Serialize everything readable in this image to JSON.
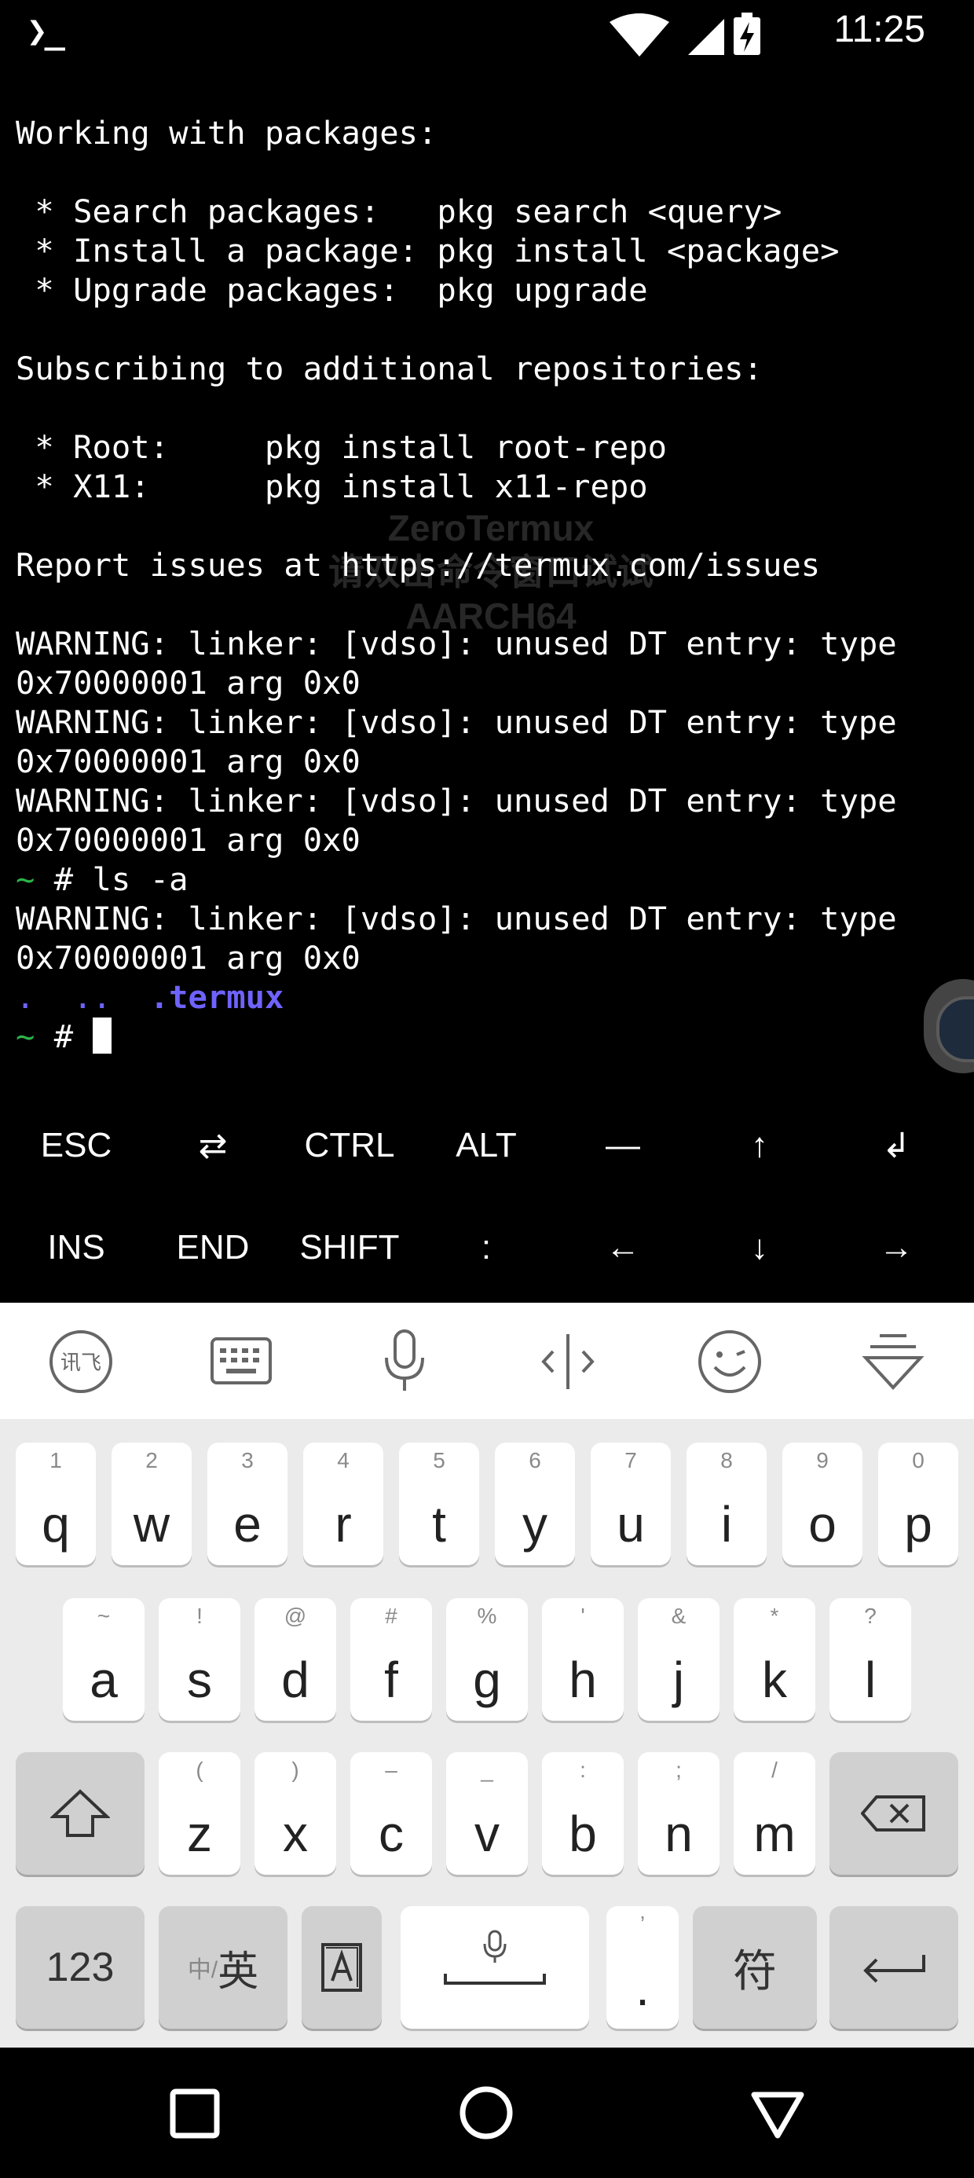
{
  "status_bar": {
    "app_glyph": "❯_",
    "time": "11:25",
    "icons": [
      "wifi-icon",
      "signal-icon",
      "battery-charging-icon"
    ]
  },
  "terminal": {
    "lines": [
      {
        "kind": "plain",
        "text": "Working with packages:"
      },
      {
        "kind": "plain",
        "text": ""
      },
      {
        "kind": "plain",
        "text": " * Search packages:   pkg search <query>"
      },
      {
        "kind": "plain",
        "text": " * Install a package: pkg install <package>"
      },
      {
        "kind": "plain",
        "text": " * Upgrade packages:  pkg upgrade"
      },
      {
        "kind": "plain",
        "text": ""
      },
      {
        "kind": "plain",
        "text": "Subscribing to additional repositories:"
      },
      {
        "kind": "plain",
        "text": ""
      },
      {
        "kind": "plain",
        "text": " * Root:     pkg install root-repo"
      },
      {
        "kind": "plain",
        "text": " * X11:      pkg install x11-repo"
      },
      {
        "kind": "plain",
        "text": ""
      },
      {
        "kind": "plain",
        "text": "Report issues at https://termux.com/issues"
      },
      {
        "kind": "plain",
        "text": ""
      },
      {
        "kind": "plain",
        "text": "WARNING: linker: [vdso]: unused DT entry: type"
      },
      {
        "kind": "plain",
        "text": "0x70000001 arg 0x0"
      },
      {
        "kind": "plain",
        "text": "WARNING: linker: [vdso]: unused DT entry: type"
      },
      {
        "kind": "plain",
        "text": "0x70000001 arg 0x0"
      },
      {
        "kind": "plain",
        "text": "WARNING: linker: [vdso]: unused DT entry: type"
      },
      {
        "kind": "plain",
        "text": "0x70000001 arg 0x0"
      },
      {
        "kind": "prompt",
        "prompt": "~",
        "hash": " # ",
        "text": "ls -a"
      },
      {
        "kind": "plain",
        "text": "WARNING: linker: [vdso]: unused DT entry: type"
      },
      {
        "kind": "plain",
        "text": "0x70000001 arg 0x0"
      },
      {
        "kind": "listing",
        "items": [
          ".",
          "..",
          ".termux"
        ]
      },
      {
        "kind": "cursor",
        "prompt": "~",
        "hash": " # "
      }
    ],
    "watermark": [
      "ZeroTermux",
      "请双击命令窗口试试",
      "AARCH64"
    ]
  },
  "extra_keys": {
    "row1": [
      "ESC",
      "⇄",
      "CTRL",
      "ALT",
      "—",
      "↑",
      "↲"
    ],
    "row2": [
      "INS",
      "END",
      "SHIFT",
      ":",
      "←",
      "↓",
      "→"
    ]
  },
  "ime_toolbar": [
    "ime-logo-icon",
    "keyboard-icon",
    "microphone-icon",
    "cursor-move-icon",
    "emoji-icon",
    "collapse-keyboard-icon"
  ],
  "keyboard": {
    "row1": [
      {
        "main": "q",
        "sub": "1"
      },
      {
        "main": "w",
        "sub": "2"
      },
      {
        "main": "e",
        "sub": "3"
      },
      {
        "main": "r",
        "sub": "4"
      },
      {
        "main": "t",
        "sub": "5"
      },
      {
        "main": "y",
        "sub": "6"
      },
      {
        "main": "u",
        "sub": "7"
      },
      {
        "main": "i",
        "sub": "8"
      },
      {
        "main": "o",
        "sub": "9"
      },
      {
        "main": "p",
        "sub": "0"
      }
    ],
    "row2": [
      {
        "main": "a",
        "sub": "~"
      },
      {
        "main": "s",
        "sub": "!"
      },
      {
        "main": "d",
        "sub": "@"
      },
      {
        "main": "f",
        "sub": "#"
      },
      {
        "main": "g",
        "sub": "%"
      },
      {
        "main": "h",
        "sub": "'"
      },
      {
        "main": "j",
        "sub": "&"
      },
      {
        "main": "k",
        "sub": "*"
      },
      {
        "main": "l",
        "sub": "?"
      }
    ],
    "row3": [
      {
        "main": "z",
        "sub": "("
      },
      {
        "main": "x",
        "sub": ")"
      },
      {
        "main": "c",
        "sub": "–"
      },
      {
        "main": "v",
        "sub": "_"
      },
      {
        "main": "b",
        "sub": ":"
      },
      {
        "main": "n",
        "sub": ";"
      },
      {
        "main": "m",
        "sub": "/"
      }
    ],
    "num_label": "123",
    "lang_label_small": "中/",
    "lang_label_big": "英",
    "period": ".",
    "period_sub": "’",
    "symbol_label": "符"
  },
  "nav_bar": [
    "recents-button",
    "home-button",
    "back-button"
  ]
}
